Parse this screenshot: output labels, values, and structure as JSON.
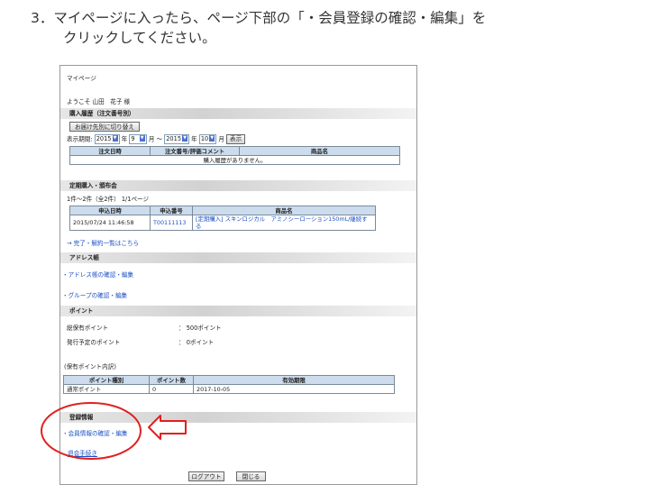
{
  "instruction": {
    "line1": "3．マイページに入ったら、ページ下部の「・会員登録の確認・編集」を",
    "line2": "クリックしてください。"
  },
  "page": {
    "title": "マイページ",
    "welcome": "ようこそ 山田　花子 様",
    "purchase_history": {
      "heading": "購入履歴（注文番号別）",
      "switch_button": "お届け先別に切り替え",
      "period_label": "表示期間:",
      "from_year": "2015",
      "year_unit": "年",
      "from_month": "9",
      "month_unit": "月",
      "tilde": "～",
      "to_year": "2015",
      "to_month": "10",
      "show_button": "表示",
      "columns": [
        "注文日時",
        "注文番号/評価コメント",
        "商品名"
      ],
      "empty_message": "購入履歴がありません。"
    },
    "subscription": {
      "heading": "定期購入・頒布会",
      "count_text": "1件～2件（全2件）  1/1ページ",
      "columns": [
        "申込日時",
        "申込番号",
        "商品名"
      ],
      "rows": [
        {
          "date": "2015/07/24 11:46:58",
          "number": "T00111113",
          "product": "[定期購入] スキンロジカル　アミノシーローション150mL/継続する"
        }
      ],
      "link": "→ 完了・解約一覧はこちら"
    },
    "address": {
      "heading": "アドレス帳",
      "link1": "・アドレス帳の確認・編集",
      "link2": "・グループの確認・編集"
    },
    "points": {
      "heading": "ポイント",
      "total_label": "総保有ポイント",
      "total_value": "：  500ポイント",
      "pending_label": "発行予定のポイント",
      "pending_value": "：  0ポイント",
      "breakdown_label": "(保有ポイント内訳)",
      "columns": [
        "ポイント種別",
        "ポイント数",
        "有効期限"
      ],
      "rows": [
        {
          "type": "通常ポイント",
          "count": "0",
          "expiry": "2017-10-05"
        }
      ]
    },
    "registration": {
      "heading": "登録情報",
      "link_edit": "・会員情報の確認・編集",
      "link_withdraw": "退会手続き"
    },
    "logout_button": "ログアウト",
    "close_button": "閉じる"
  },
  "annotation": {
    "circle_color": "#e02020",
    "arrow_color": "#e02020"
  }
}
